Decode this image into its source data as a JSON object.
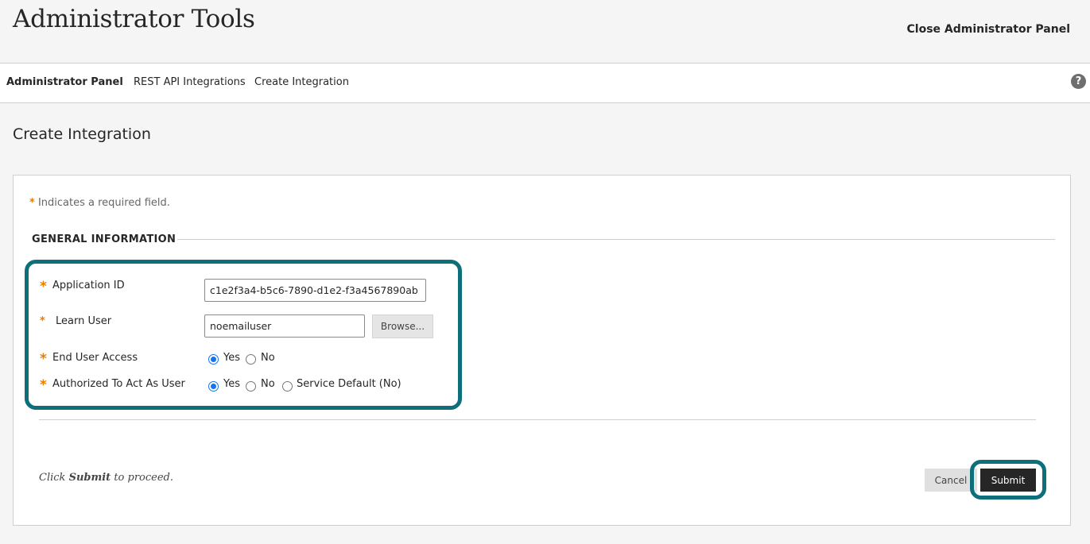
{
  "header": {
    "title": "Administrator Tools",
    "close_label": "Close Administrator Panel"
  },
  "breadcrumb": [
    {
      "label": "Administrator Panel"
    },
    {
      "label": "REST API Integrations"
    },
    {
      "label": "Create Integration"
    }
  ],
  "help": {
    "icon": "help-icon",
    "glyph": "?"
  },
  "page": {
    "title": "Create Integration"
  },
  "form": {
    "required_marker": "*",
    "required_note": "Indicates a required field.",
    "section_heading": "GENERAL INFORMATION",
    "application_id": {
      "label": "Application ID",
      "value": "c1e2f3a4-b5c6-7890-d1e2-f3a4567890ab"
    },
    "learn_user": {
      "label": "Learn User",
      "value": "noemailuser",
      "browse_label": "Browse..."
    },
    "end_user_access": {
      "label": "End User Access",
      "options": [
        "Yes",
        "No"
      ],
      "selected": "Yes"
    },
    "authorized_to_act": {
      "label": "Authorized To Act As User",
      "options": [
        "Yes",
        "No",
        "Service Default (No)"
      ],
      "selected": "Yes"
    },
    "submit_note_prefix": "Click ",
    "submit_note_bold": "Submit",
    "submit_note_suffix": " to proceed.",
    "cancel_label": "Cancel",
    "submit_label": "Submit"
  },
  "colors": {
    "accent_required": "#e67e00",
    "highlight_outline": "#0d6f7a",
    "radio_selected": "#1a73e8",
    "primary_button": "#262626"
  }
}
